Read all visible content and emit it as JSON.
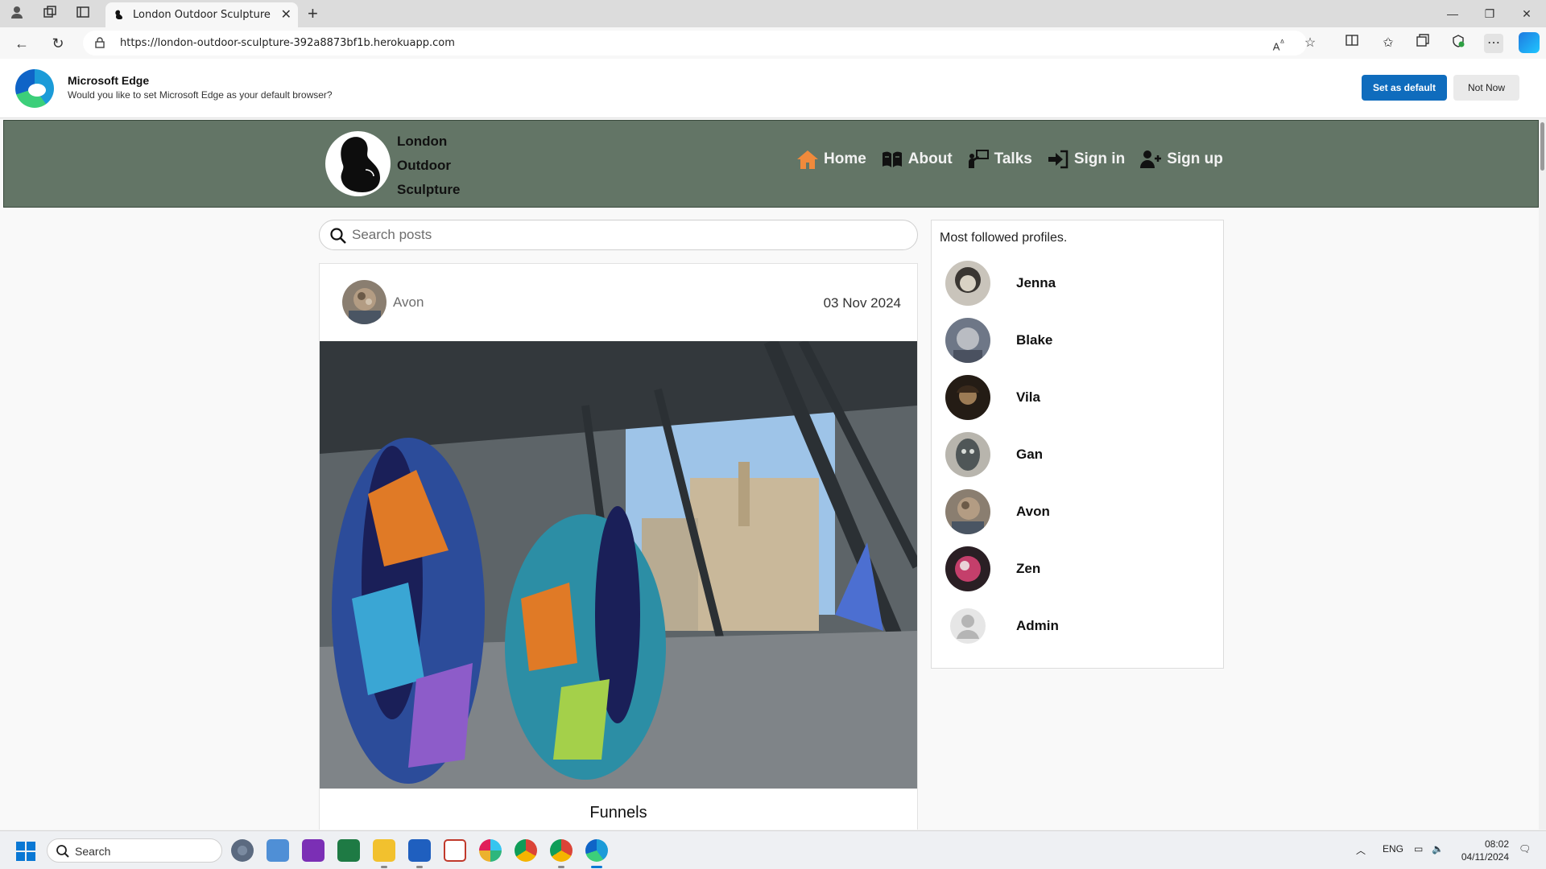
{
  "browser": {
    "tab_title": "London Outdoor Sculpture",
    "url": "https://london-outdoor-sculpture-392a8873bf1b.herokuapp.com"
  },
  "edge_prompt": {
    "title": "Microsoft Edge",
    "message": "Would you like to set Microsoft Edge as your default browser?",
    "set_default_label": "Set as default",
    "not_now_label": "Not Now"
  },
  "site": {
    "brand_lines": [
      "London",
      "Outdoor",
      "Sculpture"
    ],
    "nav": [
      {
        "label": "Home",
        "icon": "home-icon",
        "color": "#f08a3c"
      },
      {
        "label": "About",
        "icon": "book-icon"
      },
      {
        "label": "Talks",
        "icon": "talk-icon"
      },
      {
        "label": "Sign in",
        "icon": "sign-in-icon"
      },
      {
        "label": "Sign up",
        "icon": "user-plus-icon"
      }
    ],
    "search_placeholder": "Search posts"
  },
  "post": {
    "owner": "Avon",
    "date": "03 Nov 2024",
    "title": "Funnels"
  },
  "sidebar": {
    "heading": "Most followed profiles.",
    "profiles": [
      {
        "name": "Jenna"
      },
      {
        "name": "Blake"
      },
      {
        "name": "Vila"
      },
      {
        "name": "Gan"
      },
      {
        "name": "Avon"
      },
      {
        "name": "Zen"
      },
      {
        "name": "Admin"
      }
    ]
  },
  "taskbar": {
    "search_label": "Search",
    "language": "ENG",
    "time": "08:02",
    "date": "04/11/2024"
  },
  "colors": {
    "nav_bg": "#637566",
    "primary_button": "#0f6cbd",
    "home_accent": "#f08a3c"
  }
}
